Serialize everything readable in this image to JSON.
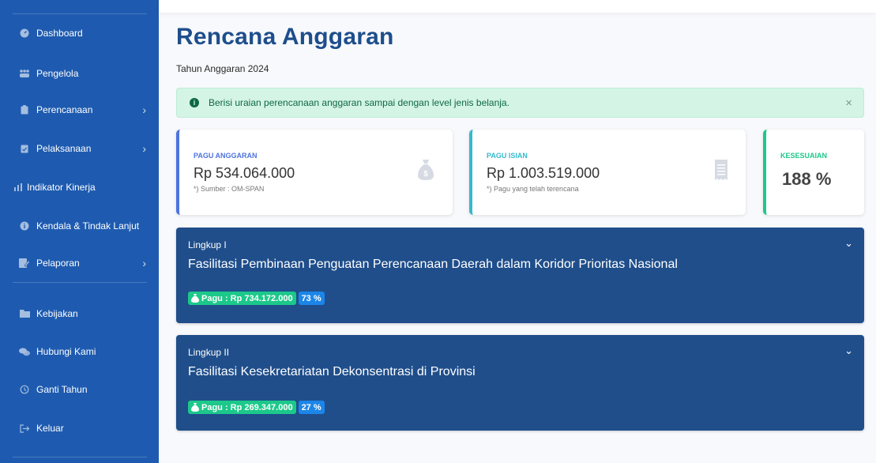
{
  "sidebar": {
    "items": [
      {
        "label": "Dashboard",
        "icon": "dashboard-icon"
      },
      {
        "label": "Pengelola",
        "icon": "users-icon"
      },
      {
        "label": "Perencanaan",
        "icon": "clipboard-icon",
        "has_submenu": true
      },
      {
        "label": "Pelaksanaan",
        "icon": "clipboard-check-icon",
        "has_submenu": true
      },
      {
        "label": "Indikator Kinerja",
        "icon": "bar-chart-icon"
      },
      {
        "label": "Kendala & Tindak Lanjut",
        "icon": "info-circle-icon"
      },
      {
        "label": "Pelaporan",
        "icon": "file-edit-icon",
        "has_submenu": true
      },
      {
        "label": "Kebijakan",
        "icon": "folder-icon"
      },
      {
        "label": "Hubungi Kami",
        "icon": "comments-icon"
      },
      {
        "label": "Ganti Tahun",
        "icon": "history-icon"
      },
      {
        "label": "Keluar",
        "icon": "sign-out-icon"
      }
    ]
  },
  "page": {
    "title": "Rencana Anggaran",
    "subtitle": "Tahun Anggaran 2024"
  },
  "alert": {
    "text": "Berisi uraian perencanaan anggaran sampai dengan level jenis belanja.",
    "close": "×"
  },
  "cards": {
    "pagu_anggaran": {
      "label": "PAGU ANGGARAN",
      "value": "Rp 534.064.000",
      "note": "*) Sumber : OM-SPAN",
      "color": "#4e73df"
    },
    "pagu_isian": {
      "label": "PAGU ISIAN",
      "value": "Rp 1.003.519.000",
      "note": "*) Pagu yang telah terencana",
      "color": "#36b9cc"
    },
    "kesesuaian": {
      "label": "KESESUAIAN",
      "value": "188 %",
      "color": "#1cc88a"
    }
  },
  "lingkup": [
    {
      "header": "Lingkup I",
      "title": "Fasilitasi Pembinaan Penguatan Perencanaan Daerah dalam Koridor Prioritas Nasional",
      "pagu": "Pagu : Rp 734.172.000",
      "percent": "73 %"
    },
    {
      "header": "Lingkup II",
      "title": "Fasilitasi Kesekretariatan Dekonsentrasi di Provinsi",
      "pagu": "Pagu : Rp 269.347.000",
      "percent": "27 %"
    }
  ],
  "colors": {
    "sidebar": "#1e5bb0",
    "title": "#1e4e8c",
    "panel": "#1f4e8b",
    "badge_green": "#1cc88a",
    "badge_blue": "#1c85e8",
    "alert_bg": "#d4f4e6"
  }
}
